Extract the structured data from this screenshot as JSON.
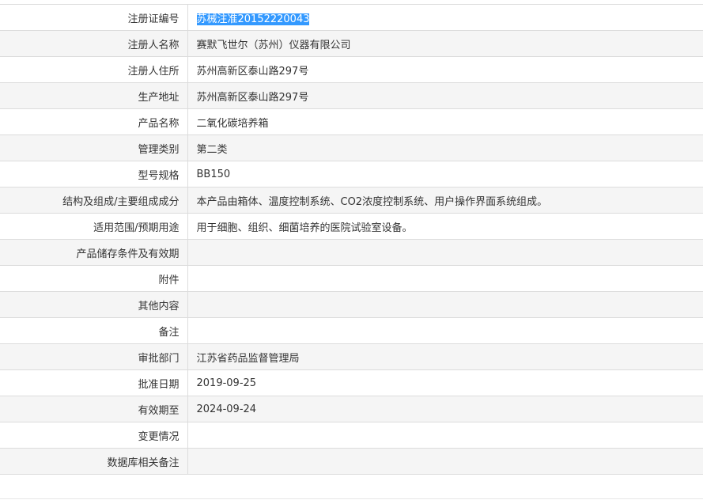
{
  "rows": [
    {
      "label": "注册证编号",
      "value": "苏械注准20152220043"
    },
    {
      "label": "注册人名称",
      "value": "赛默飞世尔（苏州）仪器有限公司"
    },
    {
      "label": "注册人住所",
      "value": "苏州高新区泰山路297号"
    },
    {
      "label": "生产地址",
      "value": "苏州高新区泰山路297号"
    },
    {
      "label": "产品名称",
      "value": "二氧化碳培养箱"
    },
    {
      "label": "管理类别",
      "value": "第二类"
    },
    {
      "label": "型号规格",
      "value": "BB150"
    },
    {
      "label": "结构及组成/主要组成成分",
      "value": "本产品由箱体、温度控制系统、CO2浓度控制系统、用户操作界面系统组成。"
    },
    {
      "label": "适用范围/预期用途",
      "value": "用于细胞、组织、细菌培养的医院试验室设备。"
    },
    {
      "label": "产品储存条件及有效期",
      "value": ""
    },
    {
      "label": "附件",
      "value": ""
    },
    {
      "label": "其他内容",
      "value": ""
    },
    {
      "label": "备注",
      "value": ""
    },
    {
      "label": "审批部门",
      "value": "江苏省药品监督管理局"
    },
    {
      "label": "批准日期",
      "value": "2019-09-25"
    },
    {
      "label": "有效期至",
      "value": "2024-09-24"
    },
    {
      "label": "变更情况",
      "value": ""
    },
    {
      "label": "数据库相关备注",
      "value": ""
    }
  ],
  "colors": {
    "selection": "#3399ff",
    "row_alt": "#f5f5f5",
    "border": "#dcdcdc"
  }
}
